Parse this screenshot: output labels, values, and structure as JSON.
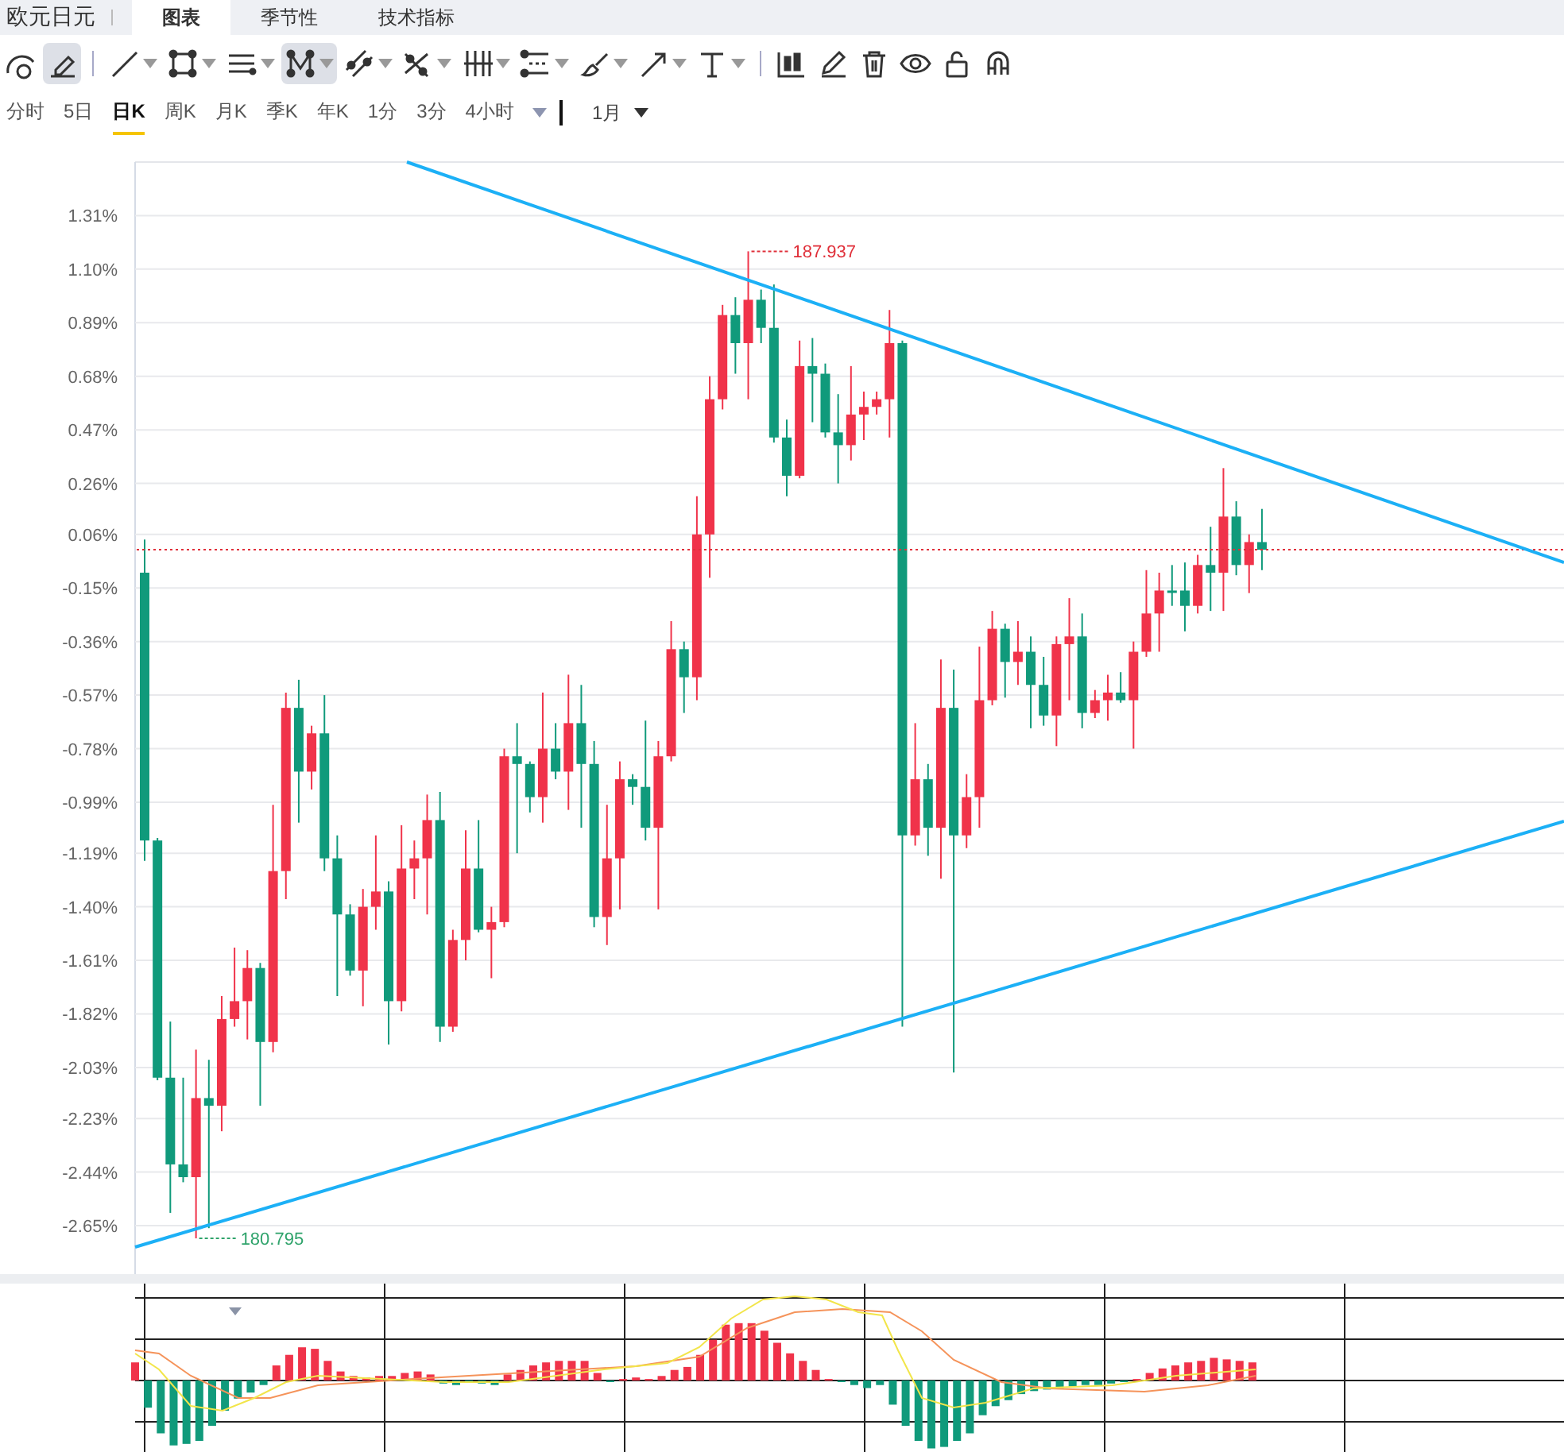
{
  "header": {
    "title": "欧元日元",
    "tabs": [
      {
        "label": "图表",
        "selected": true
      },
      {
        "label": "季节性",
        "selected": false
      },
      {
        "label": "技术指标",
        "selected": false
      }
    ]
  },
  "tools": [
    {
      "kind": "gauge",
      "selected": false,
      "menu": false
    },
    {
      "kind": "pencil-box",
      "selected": true,
      "menu": false
    },
    {
      "kind": "divider"
    },
    {
      "kind": "line",
      "selected": false,
      "menu": true
    },
    {
      "kind": "rect",
      "selected": false,
      "menu": true
    },
    {
      "kind": "hlines",
      "selected": false,
      "menu": true
    },
    {
      "kind": "nodes",
      "selected": true,
      "menu": true
    },
    {
      "kind": "parallel",
      "selected": false,
      "menu": true
    },
    {
      "kind": "cross",
      "selected": false,
      "menu": true
    },
    {
      "kind": "vlines",
      "selected": false,
      "menu": true
    },
    {
      "kind": "dashlines",
      "selected": false,
      "menu": true
    },
    {
      "kind": "brush",
      "selected": false,
      "menu": true
    },
    {
      "kind": "arrow",
      "selected": false,
      "menu": true
    },
    {
      "kind": "text",
      "selected": false,
      "menu": true
    },
    {
      "kind": "divider"
    },
    {
      "kind": "candles",
      "selected": false,
      "menu": false
    },
    {
      "kind": "pencil",
      "selected": false,
      "menu": false
    },
    {
      "kind": "trash",
      "selected": false,
      "menu": false
    },
    {
      "kind": "eye",
      "selected": false,
      "menu": false
    },
    {
      "kind": "unlock",
      "selected": false,
      "menu": false
    },
    {
      "kind": "magnet",
      "selected": false,
      "menu": false
    }
  ],
  "periods": [
    {
      "label": "分时",
      "selected": false
    },
    {
      "label": "5日",
      "selected": false
    },
    {
      "label": "日K",
      "selected": true
    },
    {
      "label": "周K",
      "selected": false
    },
    {
      "label": "月K",
      "selected": false
    },
    {
      "label": "季K",
      "selected": false
    },
    {
      "label": "年K",
      "selected": false
    },
    {
      "label": "1分",
      "selected": false
    },
    {
      "label": "3分",
      "selected": false
    },
    {
      "label": "4小时",
      "selected": false
    }
  ],
  "range": {
    "label": "1月"
  },
  "chart": {
    "chart_data": {
      "type": "candlestick",
      "ohlc": [
        [
          -0.09,
          0.04,
          -1.22,
          -1.14
        ],
        [
          -1.14,
          -1.13,
          -2.08,
          -2.07
        ],
        [
          -2.07,
          -1.85,
          -2.6,
          -2.41
        ],
        [
          -2.41,
          -2.07,
          -2.48,
          -2.46
        ],
        [
          -2.46,
          -1.96,
          -2.7,
          -2.15
        ],
        [
          -2.15,
          -2.0,
          -2.66,
          -2.18
        ],
        [
          -2.18,
          -1.75,
          -2.28,
          -1.84
        ],
        [
          -1.84,
          -1.56,
          -1.87,
          -1.77
        ],
        [
          -1.77,
          -1.57,
          -1.92,
          -1.64
        ],
        [
          -1.64,
          -1.62,
          -2.18,
          -1.93
        ],
        [
          -1.93,
          -1.0,
          -1.97,
          -1.26
        ],
        [
          -1.26,
          -0.56,
          -1.37,
          -0.62
        ],
        [
          -0.62,
          -0.51,
          -1.07,
          -0.87
        ],
        [
          -0.87,
          -0.69,
          -0.94,
          -0.72
        ],
        [
          -0.72,
          -0.57,
          -1.26,
          -1.21
        ],
        [
          -1.21,
          -1.12,
          -1.75,
          -1.43
        ],
        [
          -1.43,
          -1.39,
          -1.67,
          -1.65
        ],
        [
          -1.65,
          -1.33,
          -1.79,
          -1.4
        ],
        [
          -1.4,
          -1.12,
          -1.49,
          -1.34
        ],
        [
          -1.34,
          -1.3,
          -1.94,
          -1.77
        ],
        [
          -1.77,
          -1.08,
          -1.81,
          -1.25
        ],
        [
          -1.25,
          -1.14,
          -1.37,
          -1.21
        ],
        [
          -1.21,
          -0.96,
          -1.43,
          -1.06
        ],
        [
          -1.06,
          -0.95,
          -1.93,
          -1.87
        ],
        [
          -1.87,
          -1.49,
          -1.89,
          -1.53
        ],
        [
          -1.53,
          -1.1,
          -1.61,
          -1.25
        ],
        [
          -1.25,
          -1.06,
          -1.5,
          -1.49
        ],
        [
          -1.49,
          -1.4,
          -1.68,
          -1.46
        ],
        [
          -1.46,
          -0.78,
          -1.48,
          -0.81
        ],
        [
          -0.81,
          -0.68,
          -1.19,
          -0.84
        ],
        [
          -0.84,
          -0.83,
          -1.03,
          -0.97
        ],
        [
          -0.97,
          -0.56,
          -1.07,
          -0.78
        ],
        [
          -0.78,
          -0.68,
          -0.9,
          -0.87
        ],
        [
          -0.87,
          -0.49,
          -1.02,
          -0.68
        ],
        [
          -0.68,
          -0.53,
          -1.09,
          -0.84
        ],
        [
          -0.84,
          -0.75,
          -1.48,
          -1.44
        ],
        [
          -1.44,
          -1.0,
          -1.55,
          -1.21
        ],
        [
          -1.21,
          -0.83,
          -1.41,
          -0.9
        ],
        [
          -0.9,
          -0.88,
          -1.0,
          -0.93
        ],
        [
          -0.93,
          -0.67,
          -1.14,
          -1.09
        ],
        [
          -1.09,
          -0.75,
          -1.41,
          -0.81
        ],
        [
          -0.81,
          -0.28,
          -0.83,
          -0.39
        ],
        [
          -0.39,
          -0.36,
          -0.64,
          -0.5
        ],
        [
          -0.5,
          0.21,
          -0.59,
          0.06
        ],
        [
          0.06,
          0.68,
          -0.11,
          0.59
        ],
        [
          0.59,
          0.96,
          0.55,
          0.92
        ],
        [
          0.92,
          0.99,
          0.69,
          0.81
        ],
        [
          0.81,
          1.17,
          0.59,
          0.98
        ],
        [
          0.98,
          1.02,
          0.81,
          0.87
        ],
        [
          0.87,
          1.04,
          0.42,
          0.44
        ],
        [
          0.44,
          0.51,
          0.21,
          0.29
        ],
        [
          0.29,
          0.82,
          0.28,
          0.72
        ],
        [
          0.72,
          0.83,
          0.5,
          0.69
        ],
        [
          0.69,
          0.73,
          0.44,
          0.46
        ],
        [
          0.46,
          0.61,
          0.26,
          0.41
        ],
        [
          0.41,
          0.72,
          0.35,
          0.53
        ],
        [
          0.53,
          0.62,
          0.43,
          0.56
        ],
        [
          0.56,
          0.62,
          0.53,
          0.59
        ],
        [
          0.59,
          0.94,
          0.44,
          0.81
        ],
        [
          0.81,
          0.82,
          -1.87,
          -1.12
        ],
        [
          -1.12,
          -0.68,
          -1.16,
          -0.9
        ],
        [
          -0.9,
          -0.84,
          -1.2,
          -1.09
        ],
        [
          -1.09,
          -0.43,
          -1.29,
          -0.62
        ],
        [
          -0.62,
          -0.47,
          -2.05,
          -1.12
        ],
        [
          -1.12,
          -0.88,
          -1.17,
          -0.97
        ],
        [
          -0.97,
          -0.38,
          -1.09,
          -0.59
        ],
        [
          -0.59,
          -0.24,
          -0.61,
          -0.31
        ],
        [
          -0.31,
          -0.29,
          -0.58,
          -0.44
        ],
        [
          -0.44,
          -0.28,
          -0.53,
          -0.4
        ],
        [
          -0.4,
          -0.34,
          -0.7,
          -0.53
        ],
        [
          -0.53,
          -0.42,
          -0.69,
          -0.65
        ],
        [
          -0.65,
          -0.34,
          -0.77,
          -0.37
        ],
        [
          -0.37,
          -0.19,
          -0.59,
          -0.34
        ],
        [
          -0.34,
          -0.25,
          -0.7,
          -0.64
        ],
        [
          -0.64,
          -0.55,
          -0.66,
          -0.59
        ],
        [
          -0.59,
          -0.49,
          -0.67,
          -0.56
        ],
        [
          -0.56,
          -0.48,
          -0.6,
          -0.59
        ],
        [
          -0.59,
          -0.36,
          -0.78,
          -0.4
        ],
        [
          -0.4,
          -0.08,
          -0.42,
          -0.25
        ],
        [
          -0.25,
          -0.09,
          -0.4,
          -0.16
        ],
        [
          -0.16,
          -0.06,
          -0.22,
          -0.16
        ],
        [
          -0.16,
          -0.05,
          -0.32,
          -0.22
        ],
        [
          -0.22,
          -0.02,
          -0.25,
          -0.06
        ],
        [
          -0.06,
          0.09,
          -0.24,
          -0.09
        ],
        [
          -0.09,
          0.32,
          -0.24,
          0.13
        ],
        [
          0.13,
          0.19,
          -0.1,
          -0.06
        ],
        [
          -0.06,
          0.06,
          -0.17,
          0.03
        ],
        [
          0.03,
          0.16,
          -0.08,
          0.0
        ]
      ],
      "yticks": [
        {
          "value": 1.31,
          "label": "1.31%"
        },
        {
          "value": 1.1,
          "label": "1.10%"
        },
        {
          "value": 0.89,
          "label": "0.89%"
        },
        {
          "value": 0.68,
          "label": "0.68%"
        },
        {
          "value": 0.47,
          "label": "0.47%"
        },
        {
          "value": 0.26,
          "label": "0.26%"
        },
        {
          "value": 0.06,
          "label": "0.06%"
        },
        {
          "value": -0.15,
          "label": "-0.15%"
        },
        {
          "value": -0.36,
          "label": "-0.36%"
        },
        {
          "value": -0.57,
          "label": "-0.57%"
        },
        {
          "value": -0.78,
          "label": "-0.78%"
        },
        {
          "value": -0.99,
          "label": "-0.99%"
        },
        {
          "value": -1.19,
          "label": "-1.19%"
        },
        {
          "value": -1.4,
          "label": "-1.40%"
        },
        {
          "value": -1.61,
          "label": "-1.61%"
        },
        {
          "value": -1.82,
          "label": "-1.82%"
        },
        {
          "value": -2.03,
          "label": "-2.03%"
        },
        {
          "value": -2.23,
          "label": "-2.23%"
        },
        {
          "value": -2.44,
          "label": "-2.44%"
        },
        {
          "value": -2.65,
          "label": "-2.65%"
        }
      ],
      "ylim": [
        -2.84,
        1.52
      ],
      "grid": true,
      "annotations": [
        "187.937",
        "180.795"
      ]
    }
  }
}
